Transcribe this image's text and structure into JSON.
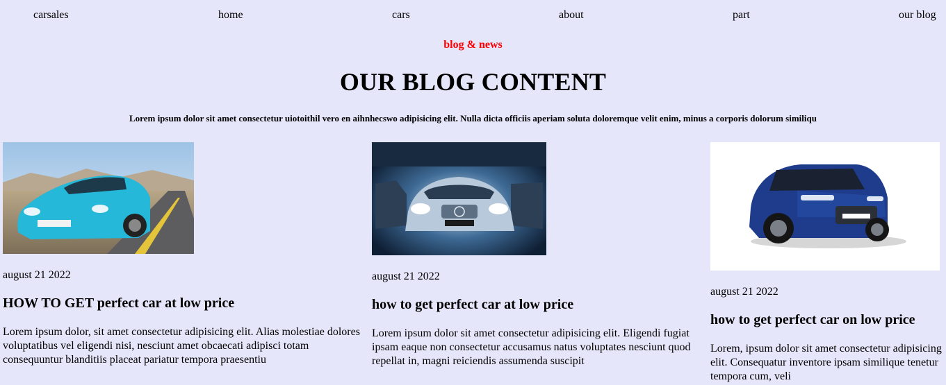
{
  "nav": {
    "brand": "carsales",
    "items": [
      "home",
      "cars",
      "about",
      "part",
      "our blog"
    ]
  },
  "header": {
    "kicker": "blog & news",
    "title": "OUR BLOG CONTENT",
    "intro": "Lorem ipsum dolor sit amet consectetur uiotoithil vero en aihnhecswo adipisicing elit. Nulla dicta officiis aperiam soluta doloremque velit enim, minus a corporis dolorum similiqu"
  },
  "colors": {
    "background": "#e6e6fa",
    "kicker": "#ff0000"
  },
  "posts": [
    {
      "image": "blue-sports-car-photo",
      "date": "august 21 2022",
      "title": "HOW TO GET perfect car at low price",
      "body": "Lorem ipsum dolor, sit amet consectetur adipisicing elit. Alias molestiae dolores voluptatibus vel eligendi nisi, nesciunt amet obcaecati adipisci totam consequuntur blanditiis placeat pariatur tempora praesentiu"
    },
    {
      "image": "silver-sedan-headlights-photo",
      "date": "august 21 2022",
      "title": "how to get perfect car at low price",
      "body": "Lorem ipsum dolor sit amet consectetur adipisicing elit. Eligendi fugiat ipsam eaque non consectetur accusamus natus voluptates nesciunt quod repellat in, magni reiciendis assumenda suscipit"
    },
    {
      "image": "blue-suv-photo",
      "date": "august 21 2022",
      "title": "how to get perfect car on low price",
      "body": "Lorem, ipsum dolor sit amet consectetur adipisicing elit. Consequatur inventore ipsam similique tenetur tempora cum, veli"
    }
  ]
}
